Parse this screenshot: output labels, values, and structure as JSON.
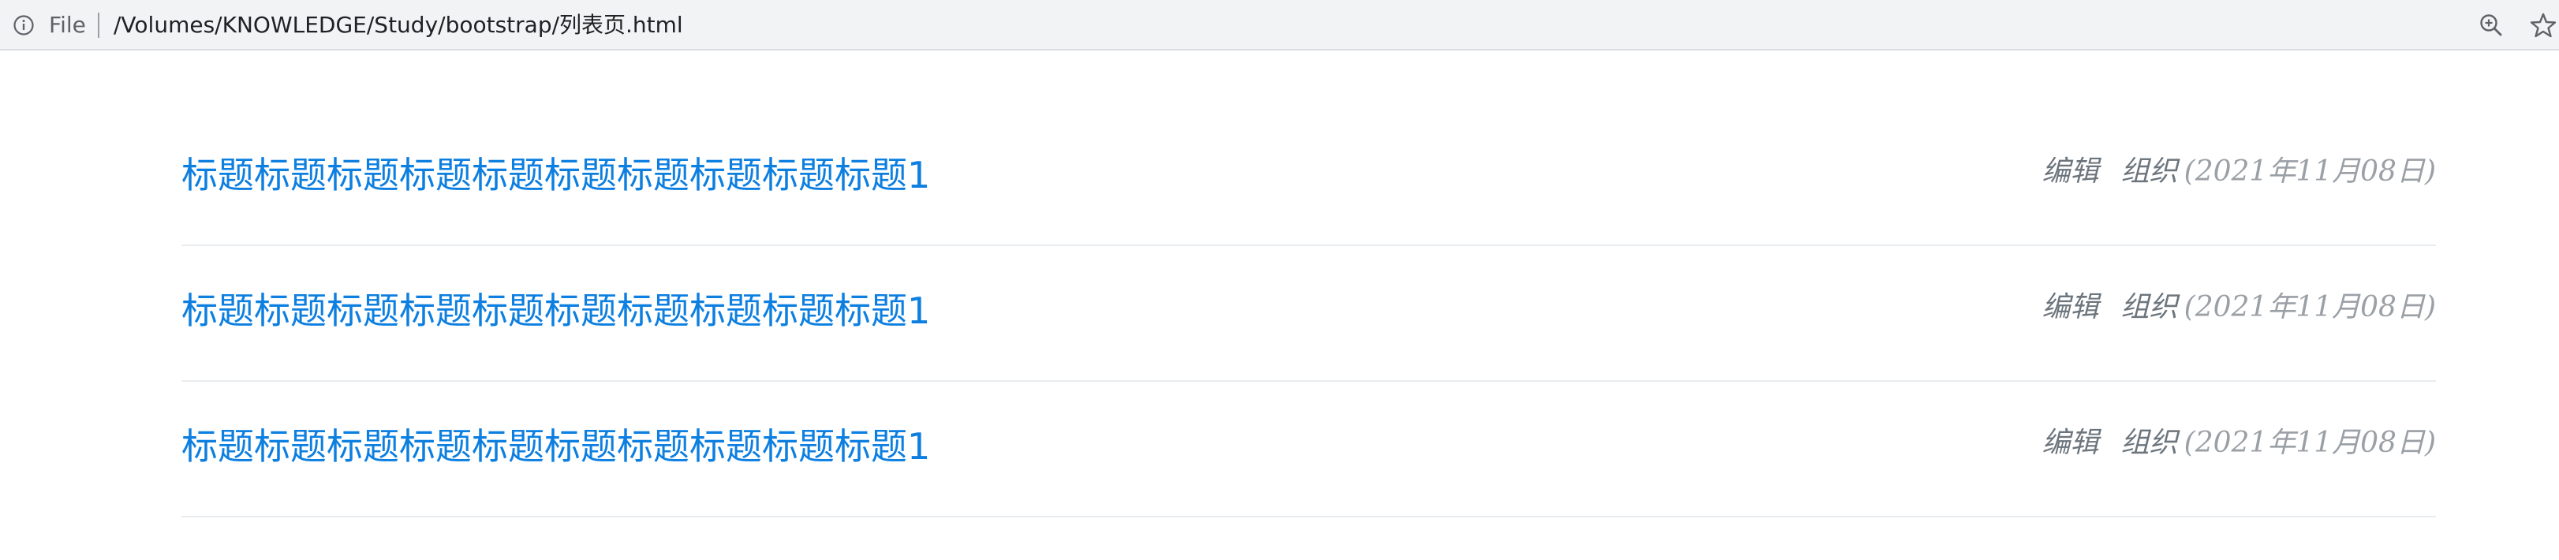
{
  "address_bar": {
    "file_label": "File",
    "url": "/Volumes/KNOWLEDGE/Study/bootstrap/列表页.html"
  },
  "icons": {
    "info": "info-circle-icon",
    "zoom": "zoom-in-icon",
    "bookmark": "star-icon"
  },
  "list": {
    "items": [
      {
        "title": "标题标题标题标题标题标题标题标题标题标题1",
        "editor": "编辑",
        "org": "组织",
        "date": "(2021年11月08日)"
      },
      {
        "title": "标题标题标题标题标题标题标题标题标题标题1",
        "editor": "编辑",
        "org": "组织",
        "date": "(2021年11月08日)"
      },
      {
        "title": "标题标题标题标题标题标题标题标题标题标题1",
        "editor": "编辑",
        "org": "组织",
        "date": "(2021年11月08日)"
      }
    ]
  },
  "colors": {
    "link": "#0d7fe0",
    "meta": "#6c757d",
    "divider": "#e9ecef"
  }
}
